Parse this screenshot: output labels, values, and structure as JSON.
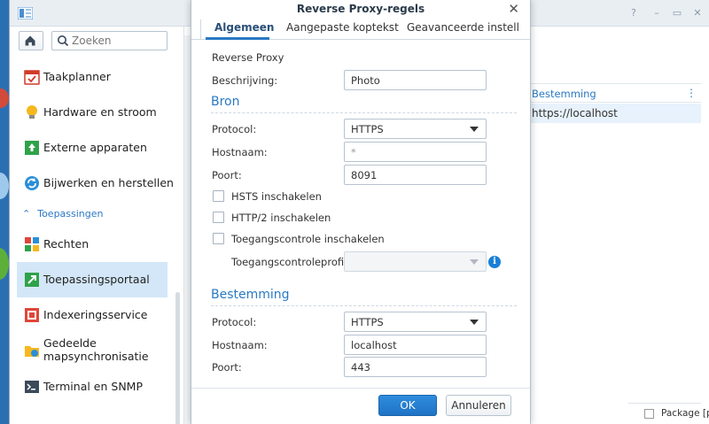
{
  "sidebar": {
    "search_placeholder": "Zoeken",
    "items": [
      {
        "label": "Taakplanner"
      },
      {
        "label": "Hardware en stroom"
      },
      {
        "label": "Externe apparaten"
      },
      {
        "label": "Bijwerken en herstellen"
      }
    ],
    "section": "Toepassingen",
    "apps": [
      {
        "label": "Rechten"
      },
      {
        "label": "Toepassingsportaal"
      },
      {
        "label": "Indexeringsservice"
      },
      {
        "label": "Gedeelde mapsynchronisatie"
      },
      {
        "label": "Terminal en SNMP"
      }
    ]
  },
  "background_grid": {
    "column": "Bestemming",
    "row_value": "https://localhost",
    "bottom_text": "Package [pl"
  },
  "modal": {
    "title": "Reverse Proxy-regels",
    "tabs": [
      "Algemeen",
      "Aangepaste koptekst",
      "Geavanceerde instellingen"
    ],
    "type_label": "Reverse Proxy",
    "description_label": "Beschrijving:",
    "description_value": "Photo",
    "source": {
      "title": "Bron",
      "protocol_label": "Protocol:",
      "protocol_value": "HTTPS",
      "hostname_label": "Hostnaam:",
      "hostname_value": "*",
      "port_label": "Poort:",
      "port_value": "8091",
      "hsts_label": "HSTS inschakelen",
      "http2_label": "HTTP/2 inschakelen",
      "access_label": "Toegangscontrole inschakelen",
      "profile_label": "Toegangscontroleprofiel:",
      "profile_value": ""
    },
    "destination": {
      "title": "Bestemming",
      "protocol_label": "Protocol:",
      "protocol_value": "HTTPS",
      "hostname_label": "Hostnaam:",
      "hostname_value": "localhost",
      "port_label": "Poort:",
      "port_value": "443"
    },
    "ok_label": "OK",
    "cancel_label": "Annuleren"
  }
}
